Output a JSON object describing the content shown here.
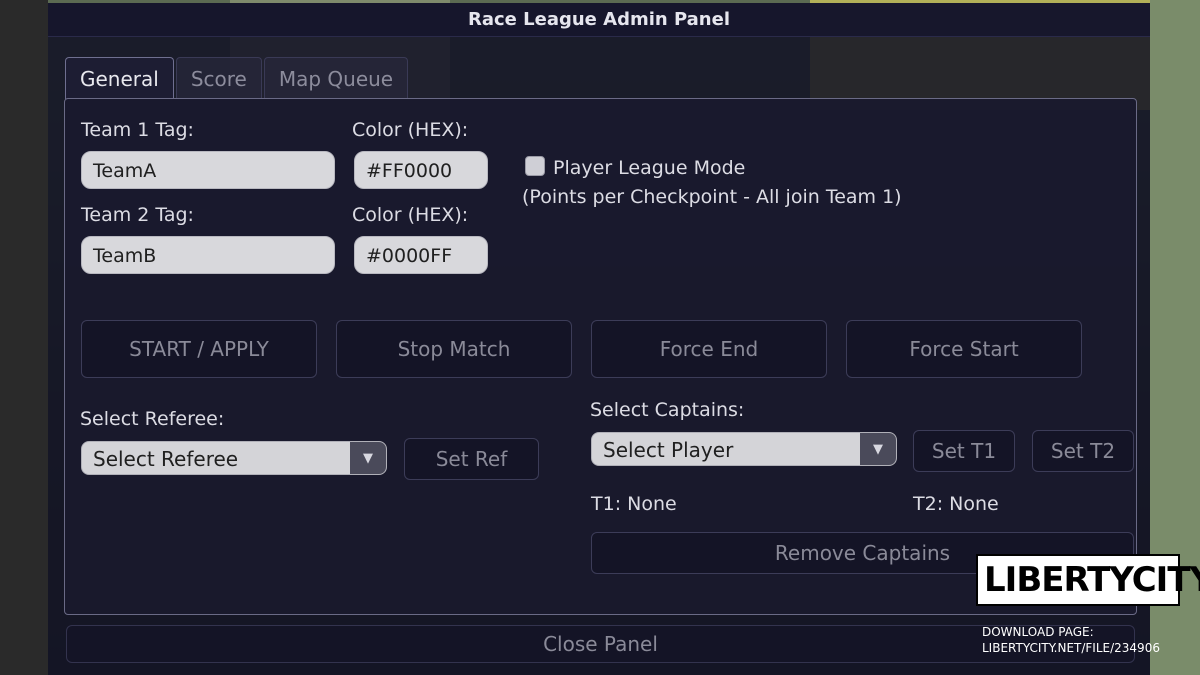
{
  "window": {
    "title": "Race League Admin Panel"
  },
  "tabs": [
    {
      "label": "General",
      "active": true
    },
    {
      "label": "Score",
      "active": false
    },
    {
      "label": "Map Queue",
      "active": false
    }
  ],
  "general": {
    "team1": {
      "tag_label": "Team 1 Tag:",
      "tag_value": "TeamA",
      "color_label": "Color (HEX):",
      "color_value": "#FF0000"
    },
    "team2": {
      "tag_label": "Team 2 Tag:",
      "tag_value": "TeamB",
      "color_label": "Color (HEX):",
      "color_value": "#0000FF"
    },
    "league_mode": {
      "label": "Player League Mode",
      "hint": "(Points per Checkpoint - All join Team 1)",
      "checked": false
    },
    "actions": {
      "start": "START / APPLY",
      "stop": "Stop Match",
      "force_end": "Force End",
      "force_start": "Force Start"
    },
    "referee": {
      "label": "Select Referee:",
      "select_value": "Select Referee",
      "set_button": "Set Ref"
    },
    "captains": {
      "label": "Select Captains:",
      "select_value": "Select Player",
      "set_t1": "Set T1",
      "set_t2": "Set T2",
      "t1_status": "T1: None",
      "t2_status": "T2: None",
      "remove_button": "Remove Captains"
    }
  },
  "footer": {
    "close_button": "Close Panel"
  },
  "watermark": {
    "logo": "LIBERTYCITY",
    "line1": "DOWNLOAD PAGE:",
    "line2": "LIBERTYCITY.NET/FILE/234906"
  },
  "icons": {
    "dropdown": "chevron-down-icon",
    "checkbox": "checkbox-icon"
  }
}
